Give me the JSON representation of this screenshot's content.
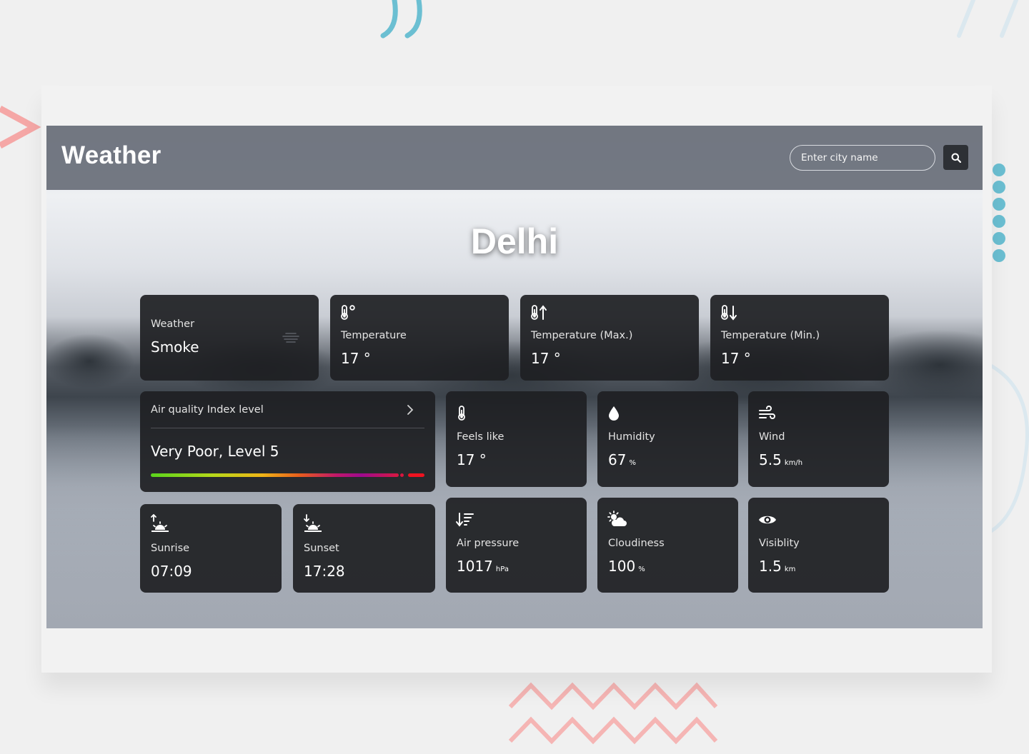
{
  "header": {
    "app_title": "Weather",
    "search_placeholder": "Enter city name"
  },
  "city": "Delhi",
  "top_cards": [
    {
      "label": "Weather",
      "value": "Smoke",
      "icon": "smoke-icon"
    },
    {
      "label": "Temperature",
      "value": "17 °",
      "icon": "thermometer-icon"
    },
    {
      "label": "Temperature (Max.)",
      "value": "17 °",
      "icon": "thermometer-up-icon"
    },
    {
      "label": "Temperature (Min.)",
      "value": "17 °",
      "icon": "thermometer-down-icon"
    }
  ],
  "aqi": {
    "label": "Air quality Index level",
    "value": "Very Poor, Level 5",
    "level": 5,
    "max_level": 5
  },
  "sun": {
    "sunrise_label": "Sunrise",
    "sunrise_value": "07:09",
    "sunset_label": "Sunset",
    "sunset_value": "17:28"
  },
  "stats": [
    {
      "label": "Feels like",
      "value": "17 °",
      "unit": "",
      "icon": "thermometer-icon"
    },
    {
      "label": "Humidity",
      "value": "67",
      "unit": "%",
      "icon": "droplet-icon"
    },
    {
      "label": "Wind",
      "value": "5.5",
      "unit": "km/h",
      "icon": "wind-icon"
    },
    {
      "label": "Air pressure",
      "value": "1017",
      "unit": "hPa",
      "icon": "pressure-icon"
    },
    {
      "label": "Cloudiness",
      "value": "100",
      "unit": "%",
      "icon": "cloud-sun-icon"
    },
    {
      "label": "Visiblity",
      "value": "1.5",
      "unit": "km",
      "icon": "eye-icon"
    }
  ],
  "colors": {
    "card_bg": "#1e1f23",
    "header_bg": "#696f7a",
    "page_bg": "#f0f0f0",
    "deco_teal": "#6bbfd2",
    "deco_pink": "#f5a7a6"
  }
}
